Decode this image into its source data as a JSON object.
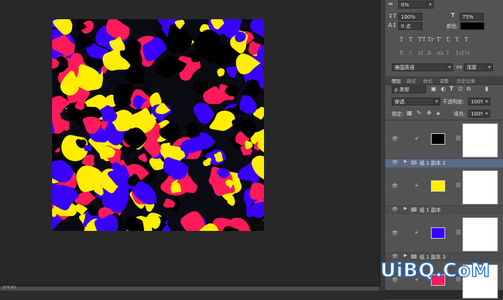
{
  "character_panel": {
    "tracking_value": "0%",
    "vertical_scale": "100%",
    "horizontal_scale": "75%",
    "baseline_shift": "0 点",
    "color_label": "颜色:",
    "color_swatch": "#000000",
    "type_buttons": [
      "T",
      "T",
      "TT",
      "Tr",
      "T'",
      "T,",
      "T",
      "T"
    ],
    "opentype_buttons": [
      "fi",
      "ℰ",
      "st",
      "A",
      "aa",
      "T",
      "1st",
      "½"
    ],
    "language": "美国英语",
    "aa_label": "aa",
    "antialias": "浑厚"
  },
  "layers_panel": {
    "tabs": [
      "图层",
      "路径",
      "样式",
      "调整",
      "历史记录"
    ],
    "active_tab": "图层",
    "filter_type": "类型",
    "blend_mode": "穿透",
    "opacity_label": "不透明度:",
    "opacity": "100%",
    "lock_label": "锁定:",
    "fill_label": "填充:",
    "fill": "100%",
    "layers": [
      {
        "kind": "fill",
        "color": "#000000"
      },
      {
        "kind": "group",
        "name": "组 1 副本 2",
        "selected": true
      },
      {
        "kind": "fill",
        "color": "#ffee00"
      },
      {
        "kind": "group",
        "name": "组 1 副本",
        "selected": false
      },
      {
        "kind": "fill",
        "color": "#3a00ff"
      },
      {
        "kind": "group",
        "name": "组 1 副本 3",
        "selected": false
      },
      {
        "kind": "fill",
        "color": "#ff1a5a"
      }
    ]
  },
  "watermark": "UiBQ.CoM",
  "status_text": "676.8%",
  "camo_colors": {
    "bg": "#0a0a12",
    "black": "#000000",
    "pink": "#ff1a5a",
    "blue": "#3a00ff",
    "yellow": "#ffee00"
  }
}
